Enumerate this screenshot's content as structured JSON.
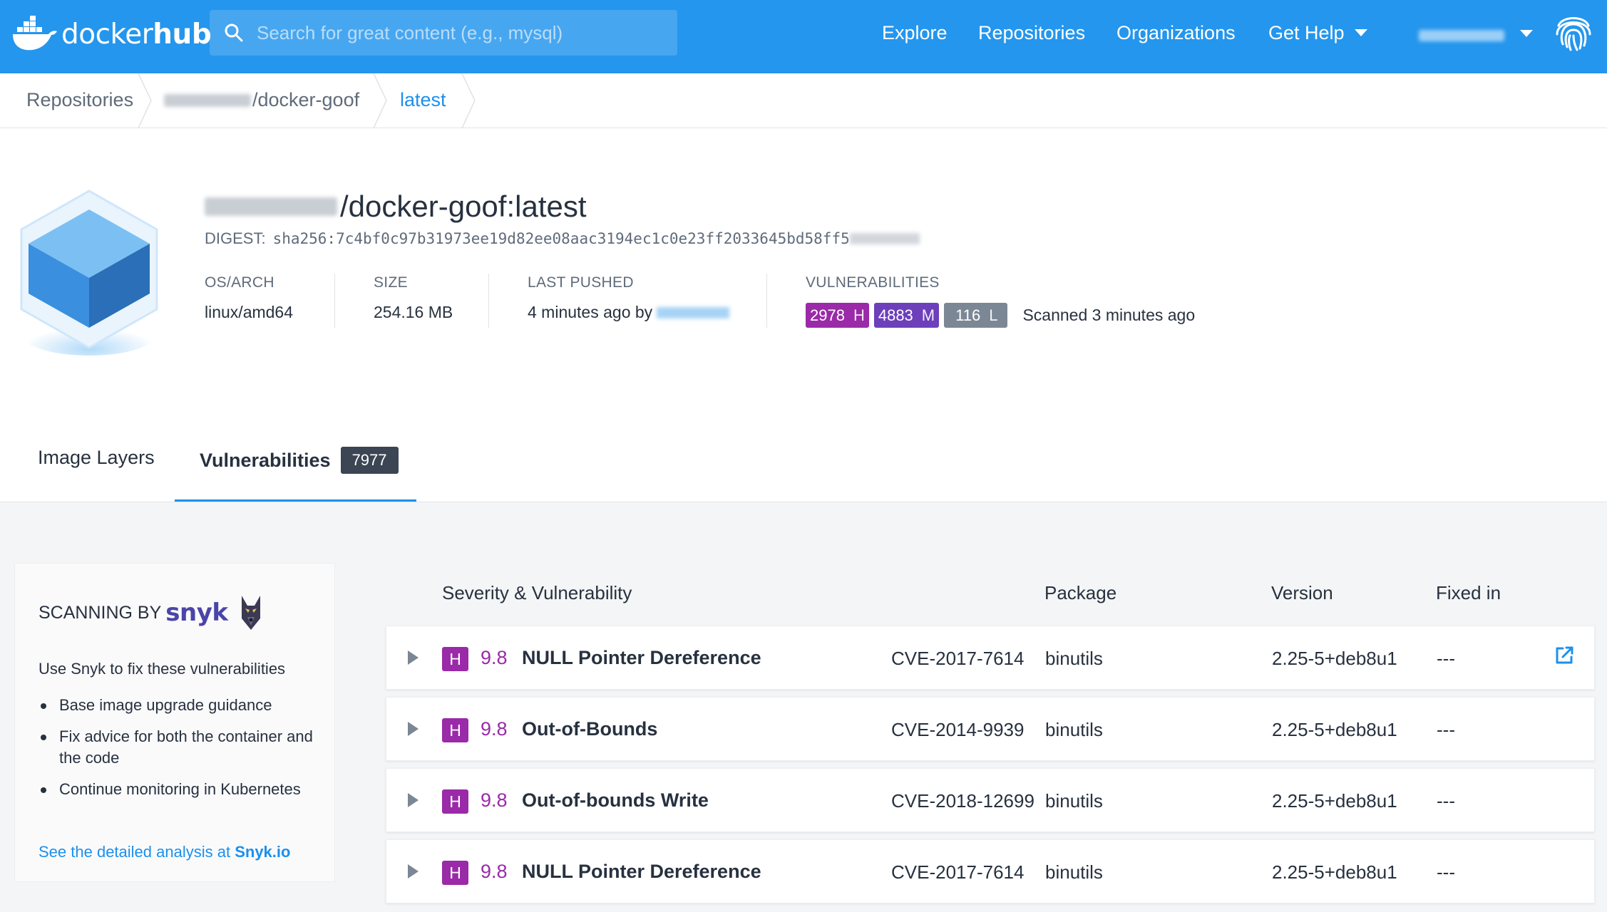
{
  "topbar": {
    "logo": {
      "word1": "docker",
      "word2": "hub"
    },
    "search_placeholder": "Search for great content (e.g., mysql)",
    "nav": {
      "explore": "Explore",
      "repositories": "Repositories",
      "organizations": "Organizations",
      "get_help": "Get Help"
    }
  },
  "breadcrumb": {
    "item1": "Repositories",
    "item2": "/docker-goof",
    "item3": "latest"
  },
  "image": {
    "title": "/docker-goof:latest",
    "digest_label": "DIGEST:",
    "digest_value": "sha256:7c4bf0c97b31973ee19d82ee08aac3194ec1c0e23ff2033645bd58ff5",
    "os_label": "OS/ARCH",
    "os_value": "linux/amd64",
    "size_label": "SIZE",
    "size_value": "254.16 MB",
    "pushed_label": "LAST PUSHED",
    "pushed_value": "4 minutes ago by",
    "vuln_label": "VULNERABILITIES",
    "vuln_high": {
      "count": "2978",
      "sev": "H"
    },
    "vuln_medium": {
      "count": "4883",
      "sev": "M"
    },
    "vuln_low": {
      "count": "116",
      "sev": "L"
    },
    "scanned": "Scanned 3 minutes ago"
  },
  "tabs": {
    "layers": "Image Layers",
    "vulnerabilities": "Vulnerabilities",
    "vuln_count": "7977"
  },
  "snyk": {
    "scanning_by": "SCANNING BY",
    "brand": "snyk",
    "description": "Use Snyk to fix these vulnerabilities",
    "bullets": [
      "Base image upgrade guidance",
      "Fix advice for both the container and the code",
      "Continue monitoring in Kubernetes"
    ],
    "link_prefix": "See the detailed analysis at",
    "link_target": "Snyk.io"
  },
  "table": {
    "headers": {
      "severity": "Severity & Vulnerability",
      "package": "Package",
      "version": "Version",
      "fixed_in": "Fixed in"
    },
    "rows": [
      {
        "sev": "H",
        "score": "9.8",
        "title": "NULL Pointer Dereference",
        "cve": "CVE-2017-7614",
        "package": "binutils",
        "version": "2.25-5+deb8u1",
        "fixed": "---"
      },
      {
        "sev": "H",
        "score": "9.8",
        "title": "Out-of-Bounds",
        "cve": "CVE-2014-9939",
        "package": "binutils",
        "version": "2.25-5+deb8u1",
        "fixed": "---"
      },
      {
        "sev": "H",
        "score": "9.8",
        "title": "Out-of-bounds Write",
        "cve": "CVE-2018-12699",
        "package": "binutils",
        "version": "2.25-5+deb8u1",
        "fixed": "---"
      },
      {
        "sev": "H",
        "score": "9.8",
        "title": "NULL Pointer Dereference",
        "cve": "CVE-2017-7614",
        "package": "binutils",
        "version": "2.25-5+deb8u1",
        "fixed": "---"
      }
    ]
  },
  "colors": {
    "brand_blue": "#2496ed",
    "high": "#9a2aa8",
    "medium": "#6d3fba",
    "low": "#7b8794",
    "link": "#1c90ed"
  },
  "icons": [
    "search-icon",
    "docker-whale-icon",
    "chevron-down-icon",
    "fingerprint-icon",
    "cube-icon",
    "snyk-dog-icon",
    "expand-arrow-icon",
    "external-link-icon"
  ]
}
